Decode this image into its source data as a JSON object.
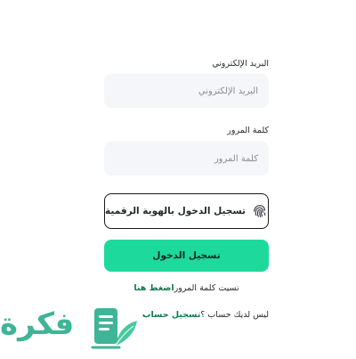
{
  "form": {
    "email_label": "البريد الإلكتروني",
    "email_placeholder": "البريد الإلكتروني",
    "password_label": "كلمة المرور",
    "password_placeholder": "كلمة المرور"
  },
  "digital_id": {
    "label": "تسجيل الدخول بالهوية الرقمية",
    "icon": "fingerprint-icon"
  },
  "login_button": {
    "label": "تسجيل الدخول"
  },
  "forgot": {
    "text": "نسيت كلمة المرور",
    "link": "اضغط هنا"
  },
  "signup": {
    "text": "ليس لديك حساب ؟",
    "link": "تسجيل حساب"
  },
  "watermark": {
    "text": "فكرة",
    "icon": "document-leaf-icon"
  },
  "colors": {
    "accent": "#1ed99c",
    "link": "#0f7a4a",
    "input_bg": "#f5f6fa",
    "logo": "#1fa884"
  }
}
